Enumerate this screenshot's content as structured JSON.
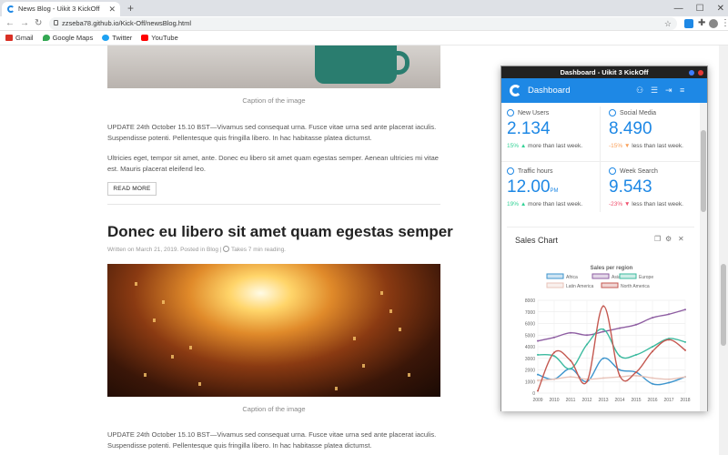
{
  "browser": {
    "tab_title": "News Blog - Uikit 3 KickOff",
    "url": "zzseba78.github.io/Kick-Off/newsBlog.html",
    "bookmarks": [
      {
        "label": "Gmail",
        "color": "#d93025"
      },
      {
        "label": "Google Maps",
        "color": "#34a853"
      },
      {
        "label": "Twitter",
        "color": "#1da1f2"
      },
      {
        "label": "YouTube",
        "color": "#ff0000"
      }
    ]
  },
  "article1": {
    "caption": "Caption of the image",
    "para1": "UPDATE 24th October 15.10 BST—Vivamus sed consequat urna. Fusce vitae urna sed ante placerat iaculis. Suspendisse potenti. Pellentesque quis fringilla libero. In hac habitasse platea dictumst.",
    "para2": "Ultricies eget, tempor sit amet, ante. Donec eu libero sit amet quam egestas semper. Aenean ultricies mi vitae est. Mauris placerat eleifend leo.",
    "read_more": "READ MORE"
  },
  "article2": {
    "title": "Donec eu libero sit amet quam egestas semper",
    "meta": "Written on March 21, 2019. Posted in Blog |",
    "reading_time": "Takes 7 min reading.",
    "caption": "Caption of the image",
    "para1": "UPDATE 24th October 15.10 BST—Vivamus sed consequat urna. Fusce vitae urna sed ante placerat iaculis. Suspendisse potenti. Pellentesque quis fringilla libero. In hac habitasse platea dictumst."
  },
  "dashboard": {
    "window_title": "Dashboard - Uikit 3 KickOff",
    "header_title": "Dashboard",
    "stats": [
      {
        "label": "New Users",
        "value": "2.134",
        "unit": "",
        "change": "15%",
        "direction": "up",
        "note": "more than last week.",
        "color": "#32d296"
      },
      {
        "label": "Social Media",
        "value": "8.490",
        "unit": "",
        "change": "-15%",
        "direction": "down",
        "note": "less than last week.",
        "color": "#faa05a"
      },
      {
        "label": "Traffic hours",
        "value": "12.00",
        "unit": "PM",
        "change": "19%",
        "direction": "up",
        "note": "more than last week.",
        "color": "#32d296"
      },
      {
        "label": "Week Search",
        "value": "9.543",
        "unit": "",
        "change": "-23%",
        "direction": "down",
        "note": "less than last week.",
        "color": "#f0506e"
      }
    ],
    "sales_card_title": "Sales Chart"
  },
  "chart_data": {
    "type": "line",
    "title": "Sales per region",
    "x": [
      2009,
      2010,
      2011,
      2012,
      2013,
      2014,
      2015,
      2016,
      2017,
      2018
    ],
    "ylim": [
      0,
      8000
    ],
    "yticks": [
      0,
      1000,
      2000,
      3000,
      4000,
      5000,
      6000,
      7000,
      8000
    ],
    "grid": true,
    "legend_position": "top",
    "series": [
      {
        "name": "Africa",
        "color": "#3e95cd",
        "values": [
          1600,
          1200,
          2100,
          1000,
          3000,
          2000,
          1800,
          800,
          900,
          1400
        ]
      },
      {
        "name": "Asia",
        "color": "#8e5ea2",
        "values": [
          4500,
          4800,
          5200,
          5000,
          5300,
          5600,
          5900,
          6500,
          6800,
          7200
        ]
      },
      {
        "name": "Europe",
        "color": "#3cba9f",
        "values": [
          3300,
          3200,
          2100,
          4200,
          5500,
          3200,
          3300,
          4000,
          4700,
          4400
        ]
      },
      {
        "name": "Latin America",
        "color": "#e8c3b9",
        "values": [
          1100,
          1200,
          1400,
          1200,
          1300,
          1400,
          1500,
          1300,
          1200,
          1400
        ]
      },
      {
        "name": "North America",
        "color": "#c45850",
        "values": [
          200,
          3500,
          2800,
          1000,
          7500,
          1500,
          1800,
          3600,
          4600,
          3700
        ]
      }
    ]
  }
}
